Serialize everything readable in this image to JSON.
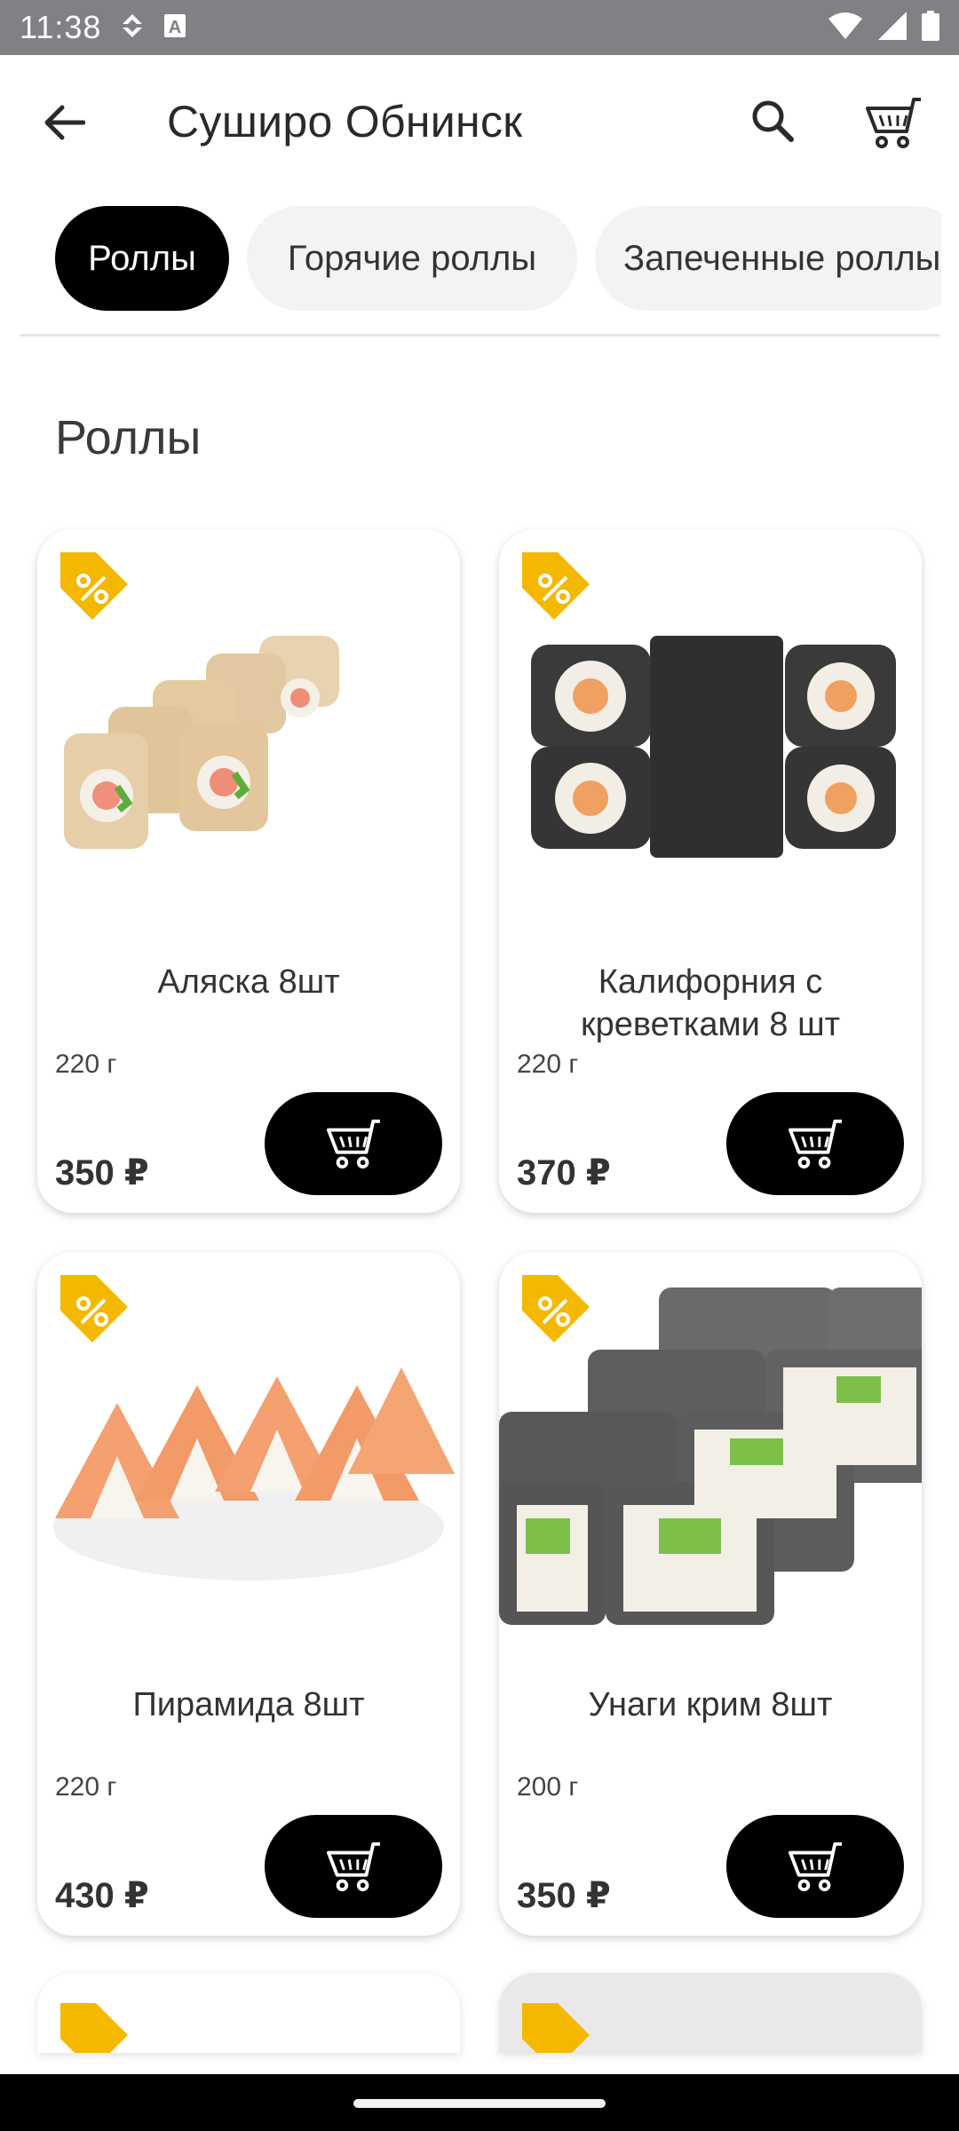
{
  "status_bar": {
    "time": "11:38",
    "icons": [
      "data-saver-icon",
      "a-keyboard-icon",
      "wifi-icon",
      "signal-icon",
      "battery-icon"
    ]
  },
  "app_bar": {
    "title": "Суширо Обнинск",
    "icons": [
      "back-arrow-icon",
      "search-icon",
      "cart-icon"
    ]
  },
  "categories": [
    {
      "label": "Роллы",
      "active": true
    },
    {
      "label": "Горячие  роллы",
      "active": false
    },
    {
      "label": "Запеченные роллы",
      "active": false
    }
  ],
  "section_title": "Роллы",
  "products": [
    {
      "name": "Аляска 8шт",
      "weight": "220 г",
      "price": "350 ₽"
    },
    {
      "name": "Калифорния с креветками 8 шт",
      "weight": "220 г",
      "price": "370 ₽"
    },
    {
      "name": "Пирамида 8шт",
      "weight": "220 г",
      "price": "430 ₽"
    },
    {
      "name": "Унаги крим 8шт",
      "weight": "200 г",
      "price": "350 ₽"
    }
  ],
  "colors": {
    "status_bar": "#818185",
    "accent_button": "#000000",
    "discount_tag": "#f5b800",
    "chip_inactive": "#f3f3f3"
  }
}
